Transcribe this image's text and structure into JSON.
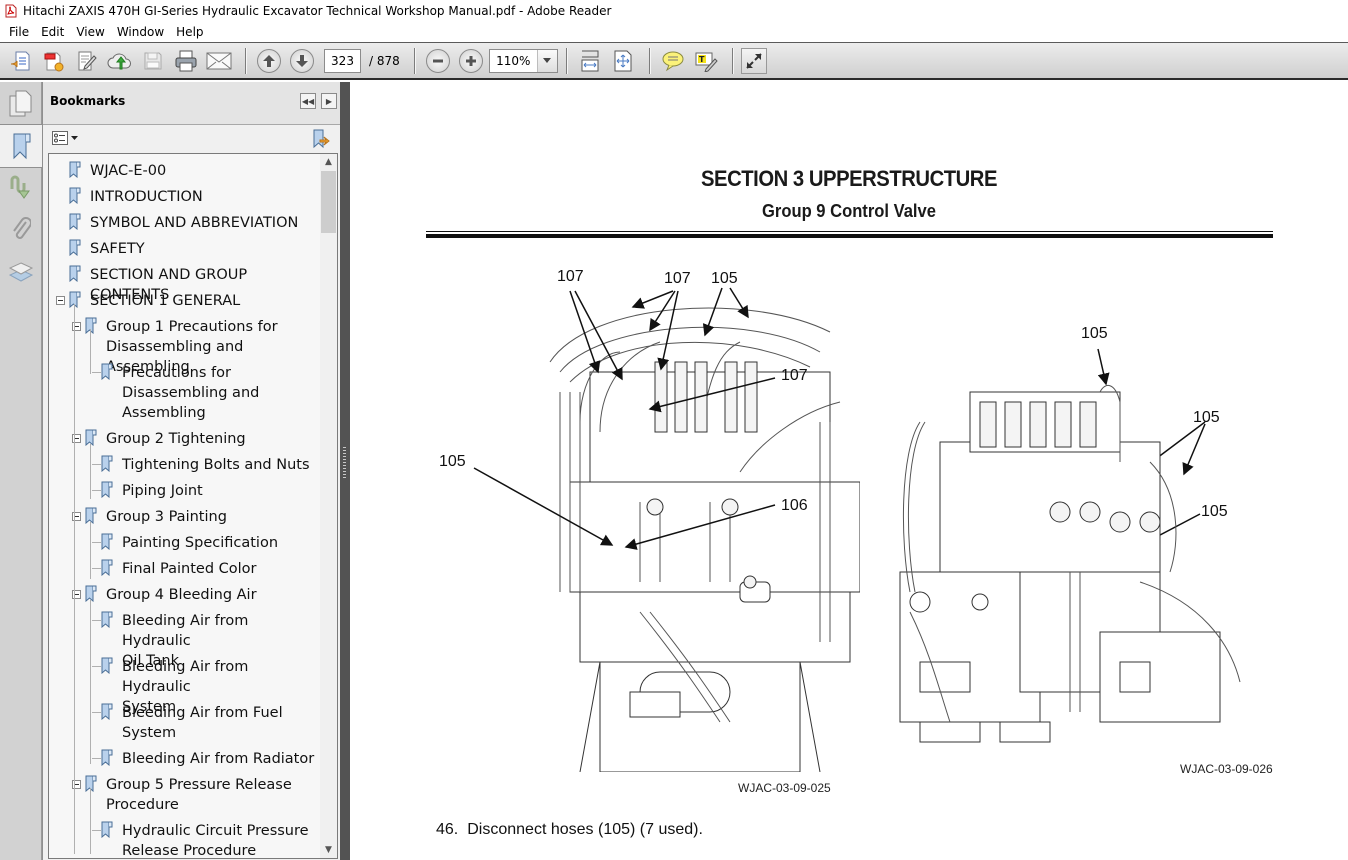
{
  "window": {
    "title": "Hitachi ZAXIS 470H GI-Series Hydraulic Excavator Technical Workshop Manual.pdf - Adobe Reader",
    "app_icon": "pdf-file-icon"
  },
  "menu": [
    "File",
    "Edit",
    "View",
    "Window",
    "Help"
  ],
  "toolbar": {
    "buttons": [
      {
        "name": "open-icon",
        "tooltip": "Open"
      },
      {
        "name": "create-pdf-icon",
        "tooltip": "Create"
      },
      {
        "name": "edit-icon",
        "tooltip": "Edit"
      },
      {
        "name": "cloud-upload-icon",
        "tooltip": "Upload"
      },
      {
        "name": "save-icon",
        "tooltip": "Save"
      },
      {
        "name": "print-icon",
        "tooltip": "Print"
      },
      {
        "name": "email-icon",
        "tooltip": "Email"
      }
    ],
    "page_current": "323",
    "page_total": "/ 878",
    "zoom": "110%",
    "view_buttons": [
      "scroll-mode-icon",
      "fit-page-icon"
    ],
    "comment_buttons": [
      "sticky-note-icon",
      "highlight-text-icon"
    ],
    "expand_button": "fullscreen-icon"
  },
  "navrail": [
    "pages-icon",
    "bookmarks-icon",
    "signatures-icon",
    "attachments-icon",
    "layers-icon"
  ],
  "bookmarks": {
    "title": "Bookmarks",
    "items": [
      {
        "label": "WJAC-E-00",
        "level": 0
      },
      {
        "label": "INTRODUCTION",
        "level": 0
      },
      {
        "label": "SYMBOL AND ABBREVIATION",
        "level": 0
      },
      {
        "label": "SAFETY",
        "level": 0
      },
      {
        "label": "SECTION AND GROUP CONTENTS",
        "level": 0
      },
      {
        "label": "SECTION 1 GENERAL",
        "level": 0,
        "expanded": true
      },
      {
        "label": "Group 1 Precautions for\nDisassembling and Assembling",
        "level": 1,
        "expanded": true
      },
      {
        "label": "Precautions for\nDisassembling and\nAssembling",
        "level": 2
      },
      {
        "label": "Group 2 Tightening",
        "level": 1,
        "expanded": true
      },
      {
        "label": "Tightening Bolts and Nuts",
        "level": 2
      },
      {
        "label": "Piping Joint",
        "level": 2
      },
      {
        "label": "Group 3 Painting",
        "level": 1,
        "expanded": true
      },
      {
        "label": "Painting Specification",
        "level": 2
      },
      {
        "label": "Final Painted Color",
        "level": 2
      },
      {
        "label": "Group 4 Bleeding Air",
        "level": 1,
        "expanded": true
      },
      {
        "label": "Bleeding Air from Hydraulic\nOil Tank",
        "level": 2
      },
      {
        "label": "Bleeding Air from Hydraulic\nSystem",
        "level": 2
      },
      {
        "label": "Bleeding Air from Fuel\nSystem",
        "level": 2
      },
      {
        "label": "Bleeding Air from Radiator",
        "level": 2
      },
      {
        "label": "Group 5 Pressure Release\nProcedure",
        "level": 1,
        "expanded": true
      },
      {
        "label": "Hydraulic Circuit Pressure\nRelease Procedure",
        "level": 2
      }
    ]
  },
  "document": {
    "section_title": "SECTION 3 UPPERSTRUCTURE",
    "group_title": "Group 9 Control Valve",
    "figure_left": {
      "caption": "WJAC-03-09-025",
      "callouts": [
        "107",
        "107",
        "105",
        "107",
        "105",
        "106"
      ]
    },
    "figure_right": {
      "caption": "WJAC-03-09-026",
      "callouts": [
        "105",
        "105",
        "105"
      ]
    },
    "step": {
      "number": "46.",
      "text": "Disconnect hoses (105) (7 used)."
    }
  }
}
